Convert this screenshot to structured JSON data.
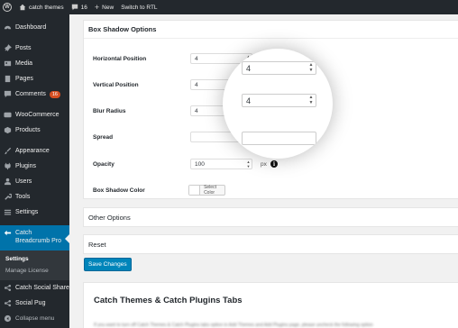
{
  "adminbar": {
    "site_name": "catch themes",
    "comments_count": "16",
    "new_label": "New",
    "rtl_label": "Switch to RTL"
  },
  "sidebar": {
    "items": [
      {
        "label": "Dashboard",
        "icon": "dashboard-icon"
      },
      {
        "label": "Posts",
        "icon": "pin-icon"
      },
      {
        "label": "Media",
        "icon": "media-icon"
      },
      {
        "label": "Pages",
        "icon": "page-icon"
      },
      {
        "label": "Comments",
        "icon": "comment-icon",
        "badge": "16"
      },
      {
        "label": "WooCommerce",
        "icon": "woocommerce-icon"
      },
      {
        "label": "Products",
        "icon": "box-icon"
      },
      {
        "label": "Appearance",
        "icon": "brush-icon"
      },
      {
        "label": "Plugins",
        "icon": "plug-icon"
      },
      {
        "label": "Users",
        "icon": "users-icon"
      },
      {
        "label": "Tools",
        "icon": "wrench-icon"
      },
      {
        "label": "Settings",
        "icon": "settings-icon"
      },
      {
        "label": "Catch Breadcrumb Pro",
        "icon": "breadcrumb-icon"
      },
      {
        "label": "Catch Social Share",
        "icon": "share-icon"
      },
      {
        "label": "Social Pug",
        "icon": "share-icon"
      }
    ],
    "submenu": [
      "Settings",
      "Manage License"
    ],
    "collapse_label": "Collapse menu"
  },
  "box_shadow": {
    "title": "Box Shadow Options",
    "fields": [
      {
        "label": "Horizontal Position",
        "value": "4",
        "unit": "px"
      },
      {
        "label": "Vertical Position",
        "value": "4",
        "unit": "px"
      },
      {
        "label": "Blur Radius",
        "value": "4",
        "unit": "px"
      },
      {
        "label": "Spread",
        "value": "",
        "unit": "px"
      },
      {
        "label": "Opacity",
        "value": "100",
        "unit": "px"
      }
    ],
    "color_label": "Box Shadow Color",
    "color_button": "Select Color"
  },
  "other_options": "Other Options",
  "reset": "Reset",
  "save_button": "Save Changes",
  "tabs_title": "Catch Themes & Catch Plugins Tabs",
  "tabs_description": "If you want to turn off Catch Themes & Catch Plugins tabs option in Add Themes and Add Plugins page, please uncheck the following option",
  "colors": {
    "admin_dark": "#23282d",
    "accent": "#0073aa",
    "button": "#0085ba",
    "badge": "#d54e21"
  }
}
